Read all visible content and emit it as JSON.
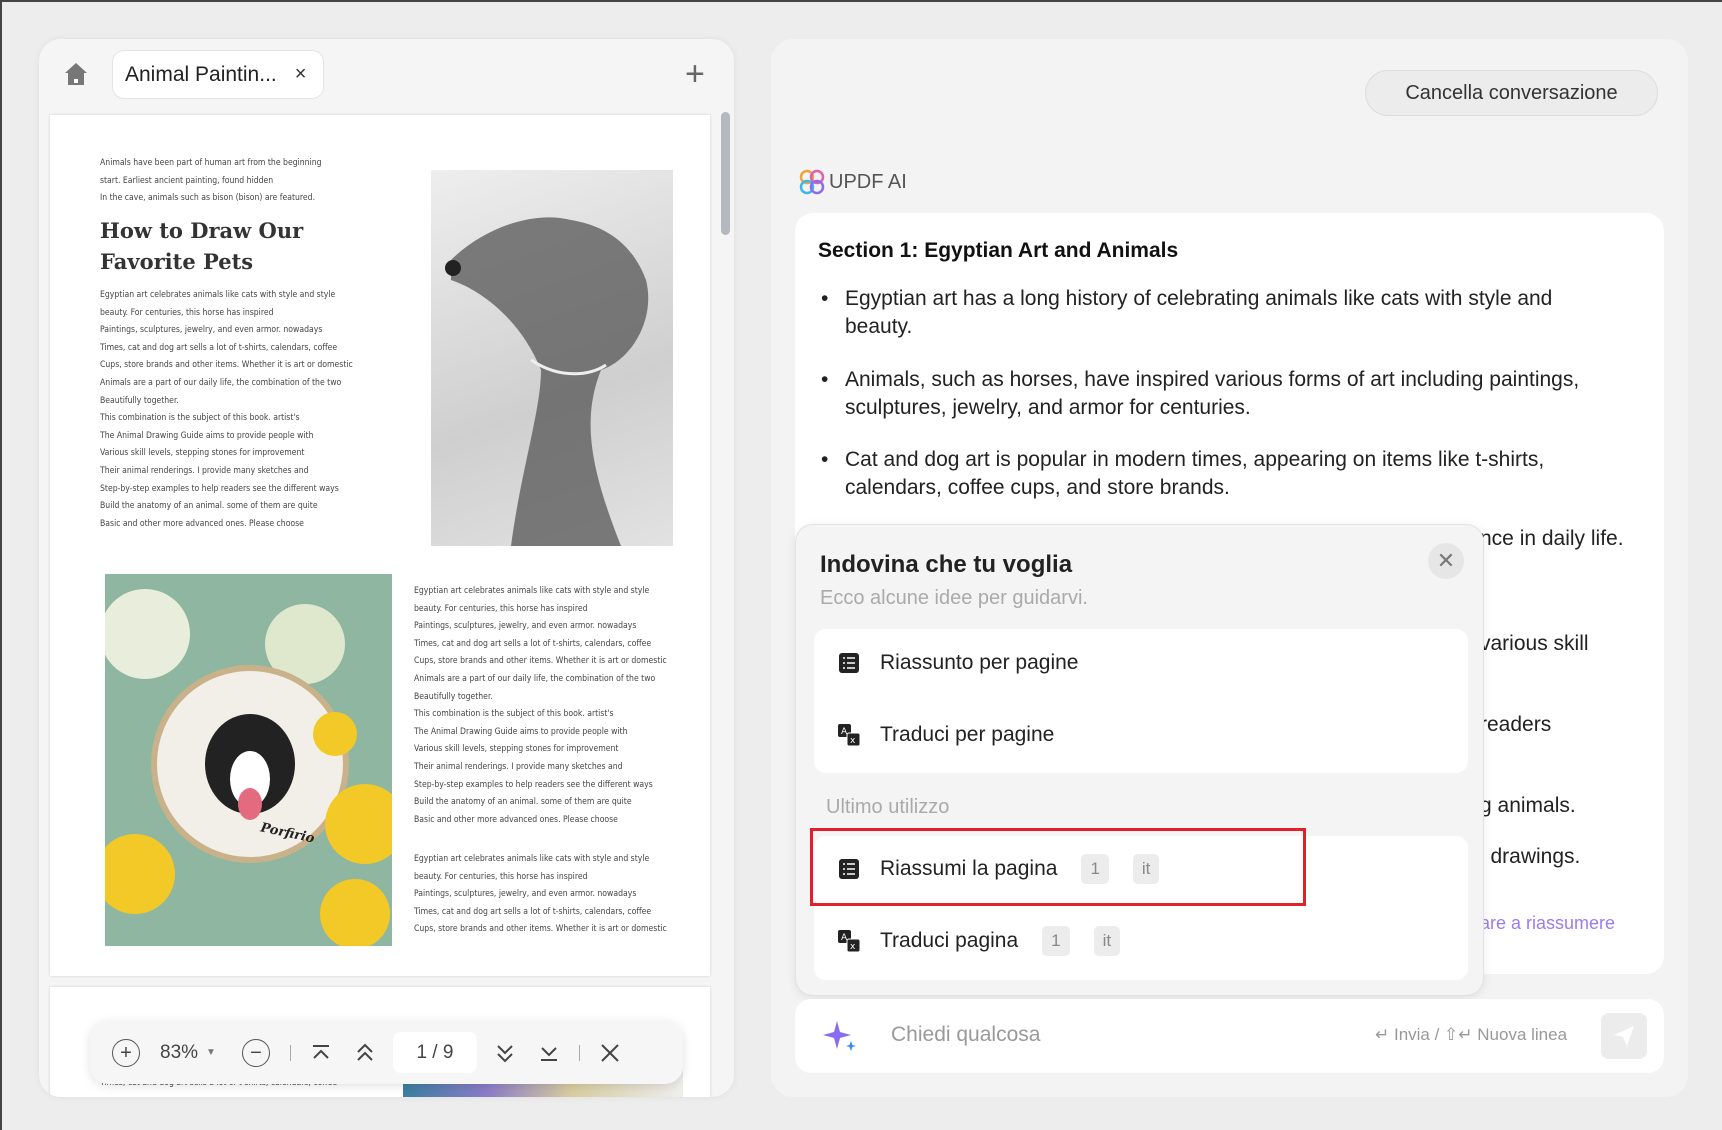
{
  "tab": {
    "title": "Animal Paintin...",
    "close": "×",
    "new_tab": "+"
  },
  "doc": {
    "intro": [
      "Animals have been part of human art from the beginning",
      "start. Earliest ancient painting, found hidden",
      "In the cave, animals such as bison (bison) are featured."
    ],
    "heading": [
      "How to Draw Our",
      "Favorite Pets"
    ],
    "col1": [
      "Egyptian art celebrates animals like cats with style and style",
      "beauty. For centuries, this horse has inspired",
      "Paintings, sculptures, jewelry, and even armor. nowadays",
      "Times, cat and dog art sells a lot of t-shirts, calendars, coffee",
      "Cups, store brands and other items. Whether it is art or domestic",
      "Animals are a part of our daily life, the combination of the two",
      "Beautifully together.",
      "This combination is the subject of this book. artist's",
      "The Animal Drawing Guide aims to provide people with",
      "Various skill levels, stepping stones for improvement",
      "Their animal renderings. I provide many sketches and",
      "Step-by-step examples to help readers see the different ways",
      "Build the anatomy of an animal. some of them are quite",
      "Basic and other more advanced ones. Please choose"
    ],
    "col3": [
      "Egyptian art celebrates animals like cats with style and style",
      "beauty. For centuries, this horse has inspired",
      "Paintings, sculptures, jewelry, and even armor. nowadays",
      "Times, cat and dog art sells a lot of t-shirts, calendars, coffee",
      "Cups, store brands and other items. Whether it is art or domestic"
    ],
    "page2_line": "Times, cat and dog art sells a lot of t-shirts, calendars, coffee",
    "embroidery_signature": "Porfirio"
  },
  "toolbar": {
    "zoom": "83%",
    "page_current": "1",
    "page_sep": "/",
    "page_total": "9"
  },
  "right": {
    "clear_button": "Cancella conversazione",
    "ai_label": "UPDF AI",
    "section_title": "Section 1: Egyptian Art and Animals",
    "bullets": [
      "Egyptian art has a long history of celebrating animals like cats with style and beauty.",
      "Animals, such as horses, have inspired various forms of art including paintings, sculptures, jewelry, and armor for centuries.",
      "Cat and dog art is popular in modern times, appearing on items like t-shirts, calendars, coffee cups, and store brands."
    ],
    "fragments": [
      "nce in daily life.",
      "various skill",
      "readers",
      "g animals.",
      "l drawings."
    ],
    "link_fragment": "are a riassumere",
    "accent": "#9b7cf0"
  },
  "popup": {
    "title": "Indovina che tu voglia",
    "subtitle": "Ecco alcune idee per guidarvi.",
    "suggestions": [
      "Riassunto per pagine",
      "Traduci per pagine"
    ],
    "recent_label": "Ultimo utilizzo",
    "recent": [
      {
        "label": "Riassumi la pagina",
        "page": "1",
        "lang": "it"
      },
      {
        "label": "Traduci pagina",
        "page": "1",
        "lang": "it"
      }
    ]
  },
  "input": {
    "placeholder": "Chiedi qualcosa",
    "hint": "↵ Invia / ⇧↵ Nuova linea"
  }
}
